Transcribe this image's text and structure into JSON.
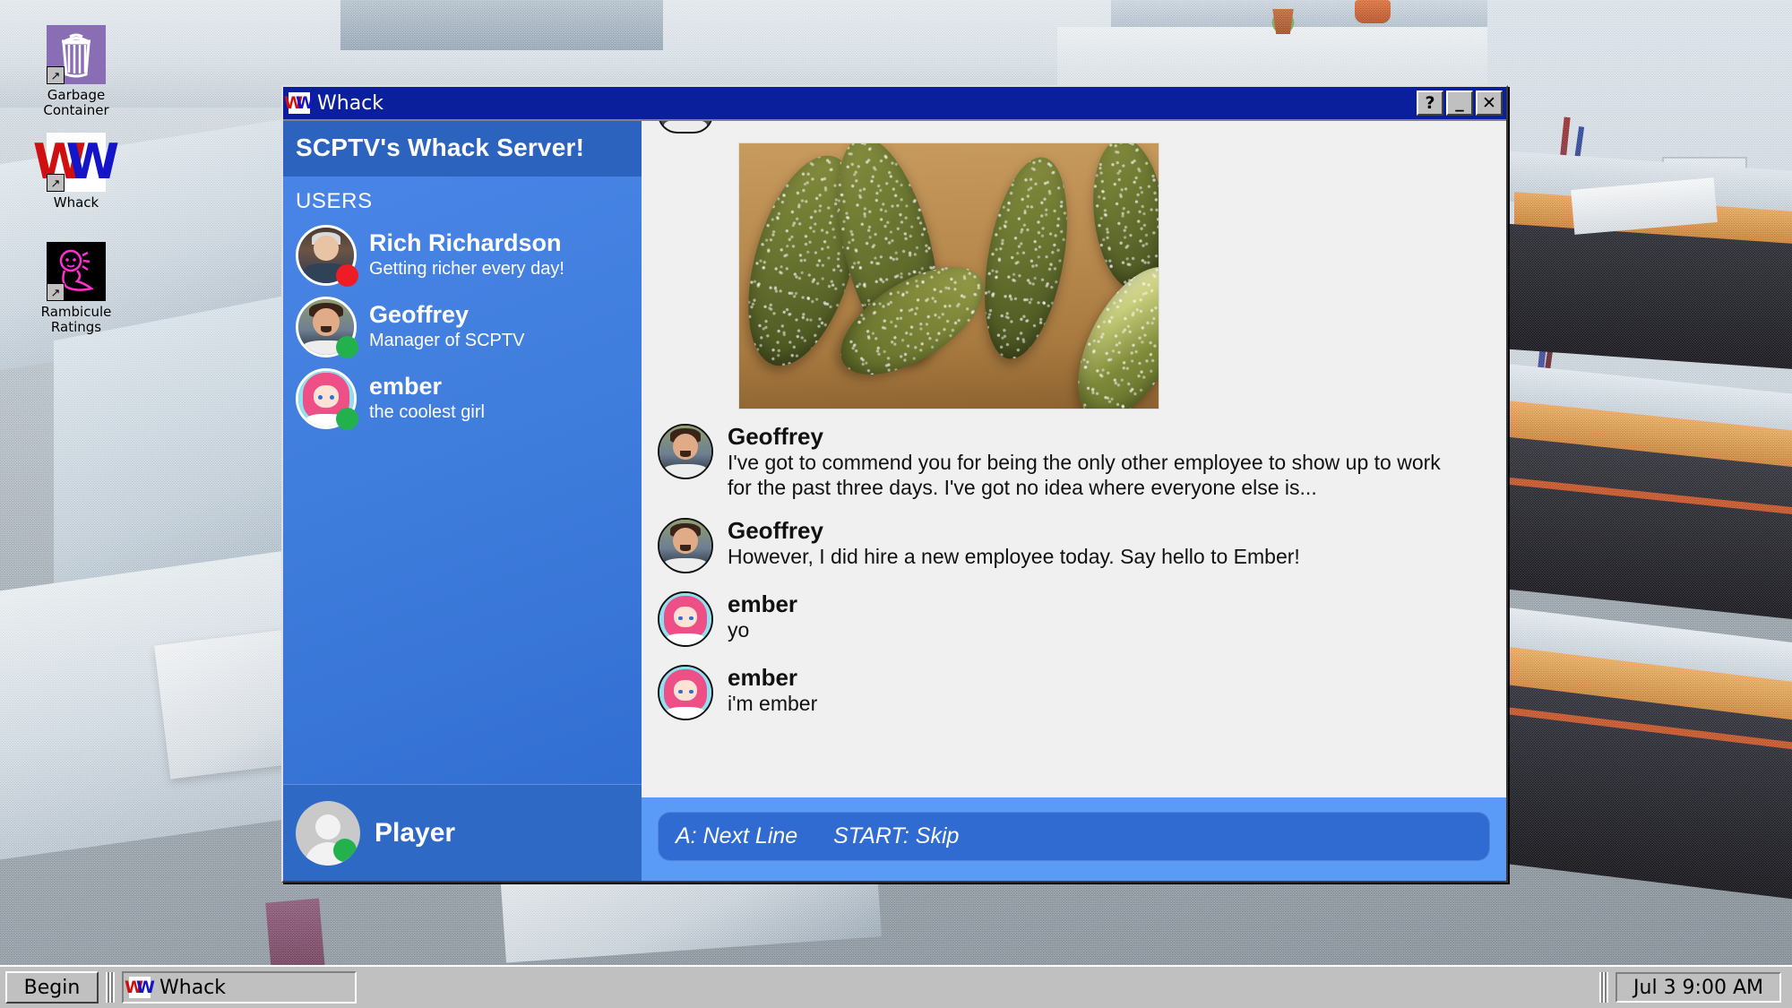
{
  "desktop": {
    "icons": [
      {
        "label": "Garbage Container",
        "icon": "trash-icon",
        "glyph": "☰"
      },
      {
        "label": "Whack",
        "icon": "whack-w-icon",
        "glyph": "W"
      },
      {
        "label": "Rambicule Ratings",
        "icon": "rambicule-ghost-icon",
        "glyph": "●"
      }
    ]
  },
  "window": {
    "title": "Whack",
    "icon": "whack-w-icon",
    "controls": {
      "help": "?",
      "minimize": "_",
      "close": "✕"
    }
  },
  "sidebar": {
    "server_title": "SCPTV's Whack Server!",
    "users_label": "USERS",
    "users": [
      {
        "name": "Rich Richardson",
        "status_text": "Getting richer every day!",
        "presence": "offline",
        "presence_color": "#ee1c25",
        "avatar": "rich-avatar"
      },
      {
        "name": "Geoffrey",
        "status_text": "Manager of SCPTV",
        "presence": "online",
        "presence_color": "#22b14c",
        "avatar": "geoffrey-avatar"
      },
      {
        "name": "ember",
        "status_text": "the coolest girl",
        "presence": "online",
        "presence_color": "#22b14c",
        "avatar": "ember-avatar"
      }
    ],
    "player": {
      "name": "Player",
      "presence": "online",
      "presence_color": "#22b14c",
      "avatar": "default-person-avatar"
    }
  },
  "chat": {
    "attachment": {
      "alt": "photo of pickles on a wooden cutting board",
      "name": "pickles-image"
    },
    "messages": [
      {
        "author": "Geoffrey",
        "text": "I've got to commend you for being the only other employee to show up to work for the past three days. I've got no idea where everyone else is...",
        "avatar": "geoffrey-avatar"
      },
      {
        "author": "Geoffrey",
        "text": "However, I did hire a new employee today. Say hello to Ember!",
        "avatar": "geoffrey-avatar"
      },
      {
        "author": "ember",
        "text": "yo",
        "avatar": "ember-avatar"
      },
      {
        "author": "ember",
        "text": "i'm ember",
        "avatar": "ember-avatar"
      }
    ],
    "hint_bar": {
      "action_primary": "A: Next Line",
      "action_secondary": "START: Skip"
    }
  },
  "taskbar": {
    "start_label": "Begin",
    "tasks": [
      {
        "label": "Whack",
        "icon": "whack-w-icon"
      }
    ],
    "clock": "Jul 3  9:00 AM"
  },
  "colors": {
    "titlebar": "#0a1f9c",
    "sidebar": "#3f7ddc",
    "server_header": "#2b63bf",
    "hint_bar": "#2f6bd0",
    "hint_bar_bg": "#5b9bf8",
    "chat_bg": "#f0f0f0",
    "chrome": "#c0c0c0"
  }
}
